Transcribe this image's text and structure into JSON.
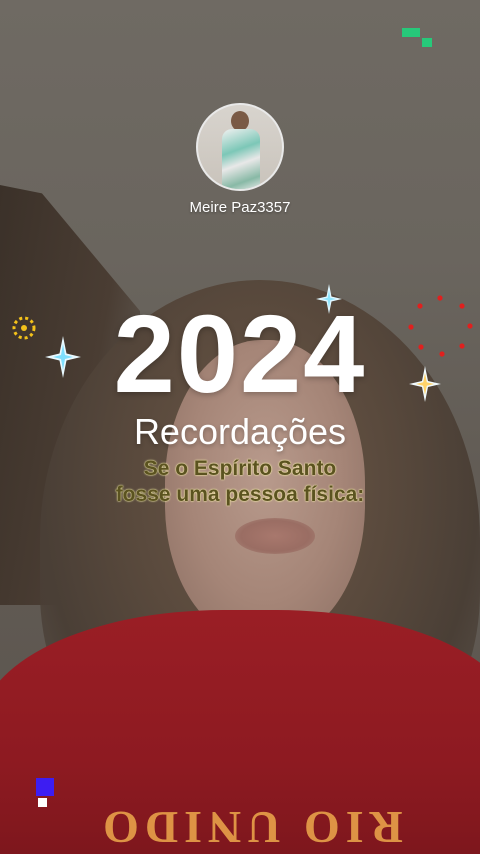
{
  "profile": {
    "username": "Meire Paz3357"
  },
  "overlay": {
    "year": "2024",
    "subtitle": "Recordações",
    "caption_line1": "Se o Espírito Santo",
    "caption_line2": "fosse uma pessoa física:"
  },
  "background": {
    "shirt_text": "RIO UNIDO"
  },
  "colors": {
    "caption_text": "#5b5320",
    "caption_glow": "#fff8b0",
    "shirt": "#9a1e25",
    "green_accent": "#27c97a",
    "blue_accent": "#3d1df2"
  },
  "icons": {
    "sparkle": "four-point-star",
    "ring": "dotted-ring",
    "red_ring": "red-dot-ring"
  }
}
